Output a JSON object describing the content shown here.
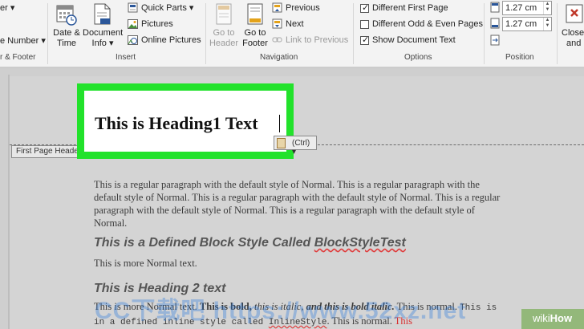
{
  "ribbon": {
    "header_footer": {
      "partial_top": "er",
      "page_number": "e Number",
      "group_label": "r & Footer"
    },
    "insert": {
      "date_time": [
        "Date &",
        "Time"
      ],
      "document_info": [
        "Document",
        "Info"
      ],
      "quick_parts": "Quick Parts",
      "pictures": "Pictures",
      "online_pictures": "Online Pictures",
      "group_label": "Insert"
    },
    "navigation": {
      "go_to_header": [
        "Go to",
        "Header"
      ],
      "go_to_footer": [
        "Go to",
        "Footer"
      ],
      "previous": "Previous",
      "next": "Next",
      "link_to_previous": "Link to Previous",
      "group_label": "Navigation"
    },
    "options": {
      "different_first_page": "Different First Page",
      "different_odd_even": "Different Odd & Even Pages",
      "show_document_text": "Show Document Text",
      "group_label": "Options"
    },
    "position": {
      "header_from_top": "1.27 cm",
      "footer_from_bottom": "1.27 cm",
      "group_label": "Position"
    },
    "close": {
      "label": [
        "Close",
        "and"
      ]
    }
  },
  "document": {
    "header_tab": "First Page Header",
    "heading1": "This is Heading1 Text",
    "paste_options": "(Ctrl)",
    "para1": "This is a regular paragraph with the default style of Normal. This is a regular paragraph with the default style of Normal. This is a regular paragraph with the default style of Normal. This is a regular paragraph with the default style of Normal. This is a regular paragraph with the default style of Normal.",
    "block_style_heading_pre": "This is a Defined Block Style Called ",
    "block_style_heading_name": "BlockStyleTest",
    "more_normal": "This is more Normal text.",
    "heading2": "This is Heading 2 text",
    "last_para": {
      "t1": "This is more Normal text. ",
      "bold": "This is bold, ",
      "italic": "this is italic, ",
      "bold_italic": "and this is bold italic.",
      "t2": " This is normal. ",
      "mono1": "This is in a defined inline style called ",
      "mono_name": "InlineStyle",
      "t3": ". This is normal. ",
      "red": "This"
    }
  },
  "overlays": {
    "watermark": "CC下载吧 https://www.52xz.net",
    "badge_wiki": "wiki",
    "badge_how": "How"
  },
  "colors": {
    "highlight": "#22e22b",
    "ribbon_bg": "#f3f3f3",
    "doc_bg": "#d4d4d4"
  }
}
